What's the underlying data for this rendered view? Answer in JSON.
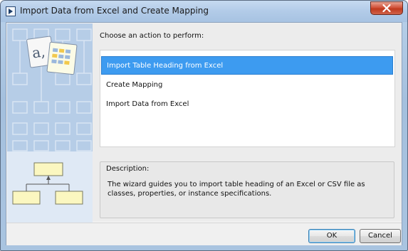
{
  "window": {
    "title": "Import Data from Excel and Create Mapping",
    "app_icon": "play-arrow-icon",
    "close_icon": "close-x-icon"
  },
  "wizard": {
    "image": "wizard-illustration",
    "prompt": "Choose an action to perform:",
    "actions": [
      {
        "label": "Import Table Heading from Excel",
        "selected": true
      },
      {
        "label": "Create Mapping",
        "selected": false
      },
      {
        "label": "Import Data from Excel",
        "selected": false
      }
    ],
    "description_label": "Description:",
    "description_text": "The wizard guides you to import table heading of an Excel or CSV file as classes, properties, or instance specifications."
  },
  "buttons": {
    "ok_label": "OK",
    "cancel_label": "Cancel"
  },
  "colors": {
    "selection": "#3d9bf0",
    "title_bar": "#b2cbe8",
    "close_button": "#c03a1e"
  }
}
